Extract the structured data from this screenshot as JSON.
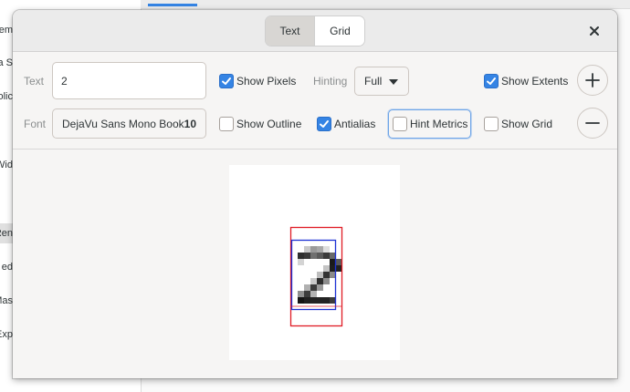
{
  "background_app": {
    "sidebar_fragments": [
      "em",
      "a S",
      "olic",
      "Wid",
      "Ren",
      "ed",
      "Mas",
      "Exp"
    ]
  },
  "dialog": {
    "tabs": [
      {
        "label": "Text",
        "active": true
      },
      {
        "label": "Grid",
        "active": false
      }
    ],
    "close_icon": "close-icon",
    "controls": {
      "text_label": "Text",
      "text_value": "2",
      "font_label": "Font",
      "font_name": "DejaVu Sans Mono Book",
      "font_size": "10",
      "show_pixels": {
        "label": "Show Pixels",
        "checked": true
      },
      "show_outline": {
        "label": "Show Outline",
        "checked": false
      },
      "hinting_label": "Hinting",
      "hinting_value": "Full",
      "antialias": {
        "label": "Antialias",
        "checked": true
      },
      "hint_metrics": {
        "label": "Hint Metrics",
        "checked": false
      },
      "show_extents": {
        "label": "Show Extents",
        "checked": true
      },
      "show_grid": {
        "label": "Show Grid",
        "checked": false
      },
      "zoom_in_icon": "plus-icon",
      "zoom_out_icon": "minus-icon"
    }
  },
  "colors": {
    "accent": "#3584e4",
    "logical_extent": "#e01b24",
    "ink_extent": "#1c31d4"
  }
}
